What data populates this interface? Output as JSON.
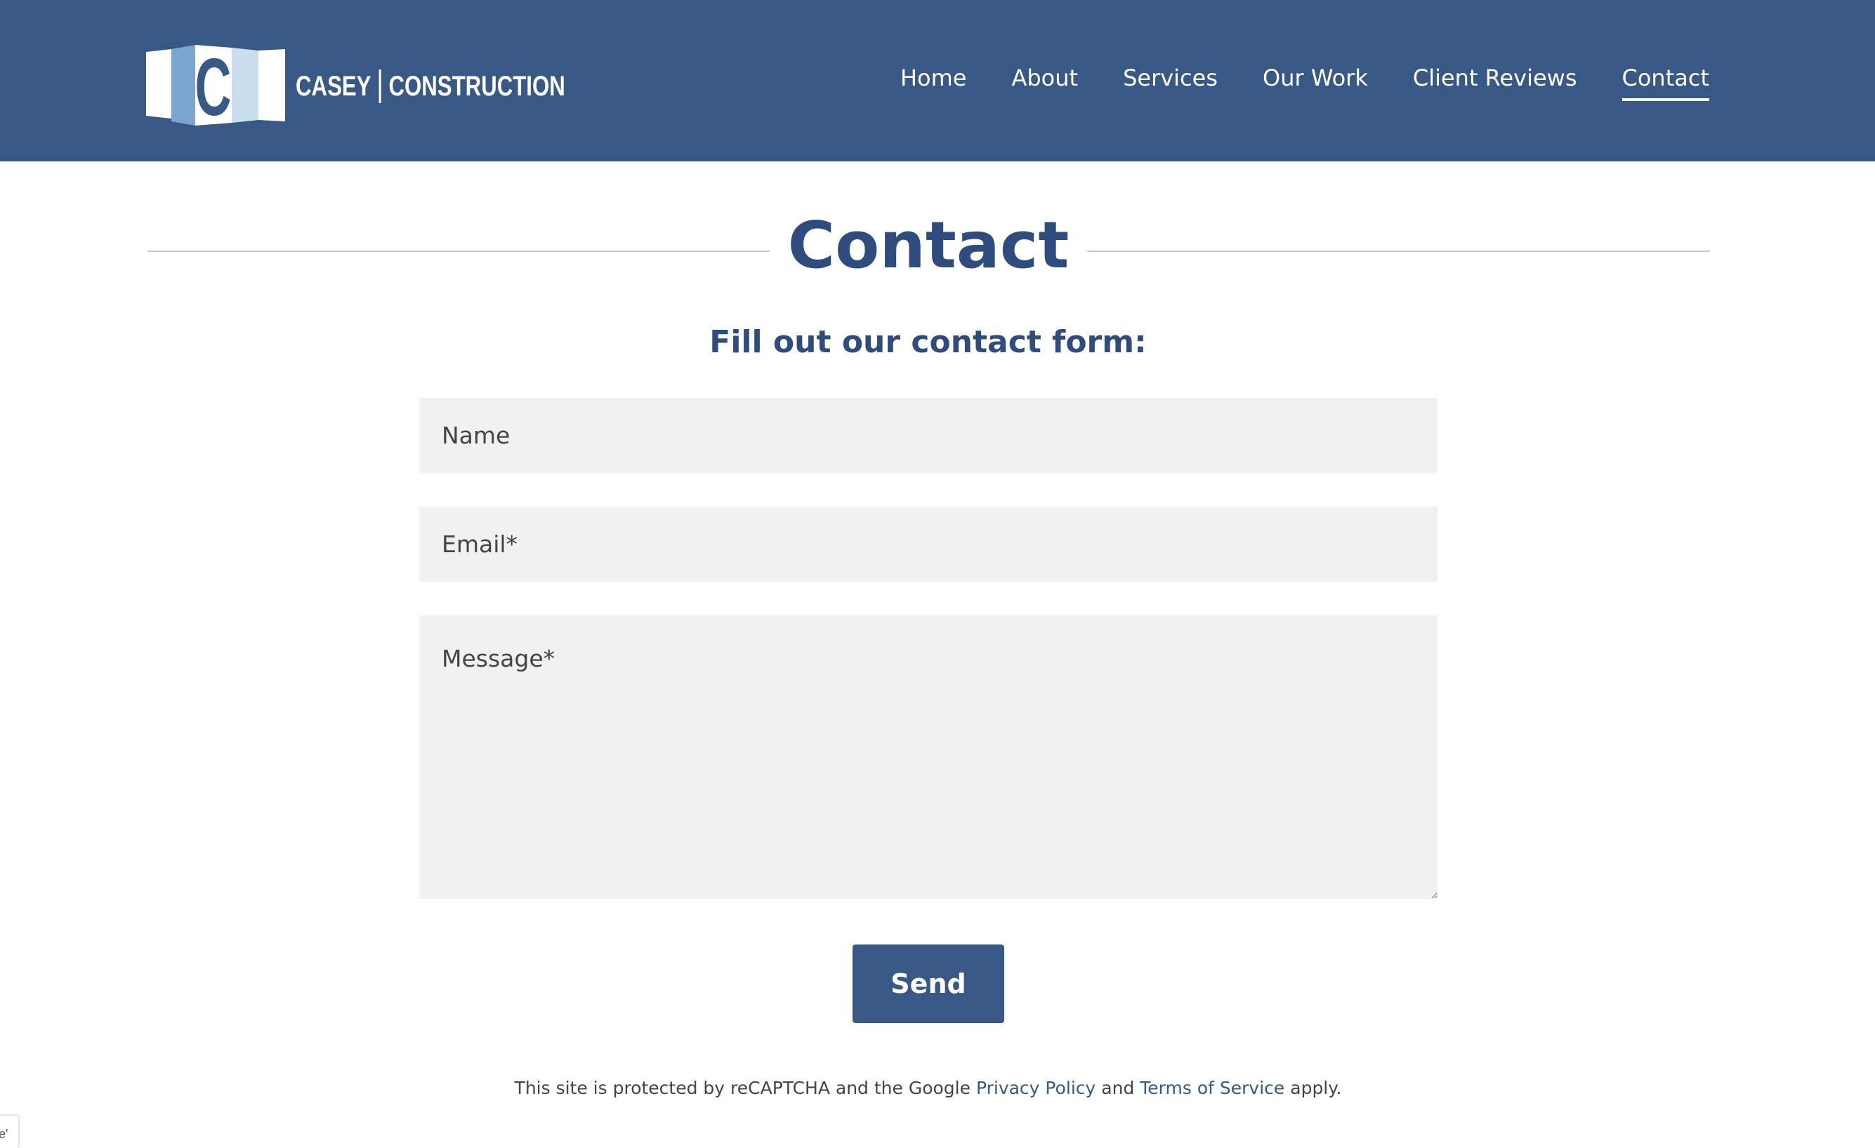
{
  "brand": {
    "logo_text_first": "Casey",
    "logo_text_second": "Construction",
    "logo_letter": "C",
    "colors": {
      "primary": "#385885",
      "heading": "#2e4d7e",
      "field_bg": "#f1f1f1",
      "logo_light_blue": "#c9dff0",
      "logo_mid_blue": "#7aa5d2"
    }
  },
  "nav": {
    "items": [
      {
        "label": "Home",
        "active": false
      },
      {
        "label": "About",
        "active": false
      },
      {
        "label": "Services",
        "active": false
      },
      {
        "label": "Our Work",
        "active": false
      },
      {
        "label": "Client Reviews",
        "active": false
      },
      {
        "label": "Contact",
        "active": true
      }
    ]
  },
  "page": {
    "title": "Contact",
    "subtitle": "Fill out our contact form:"
  },
  "form": {
    "name_placeholder": "Name",
    "email_placeholder": "Email*",
    "message_placeholder": "Message*",
    "send_label": "Send"
  },
  "recaptcha": {
    "prefix": "This site is protected by reCAPTCHA and the Google",
    "privacy_link": "Privacy Policy",
    "and_text": "and",
    "terms_link": "Terms of Service",
    "suffix": "apply.",
    "badge_fragment": "e'"
  }
}
